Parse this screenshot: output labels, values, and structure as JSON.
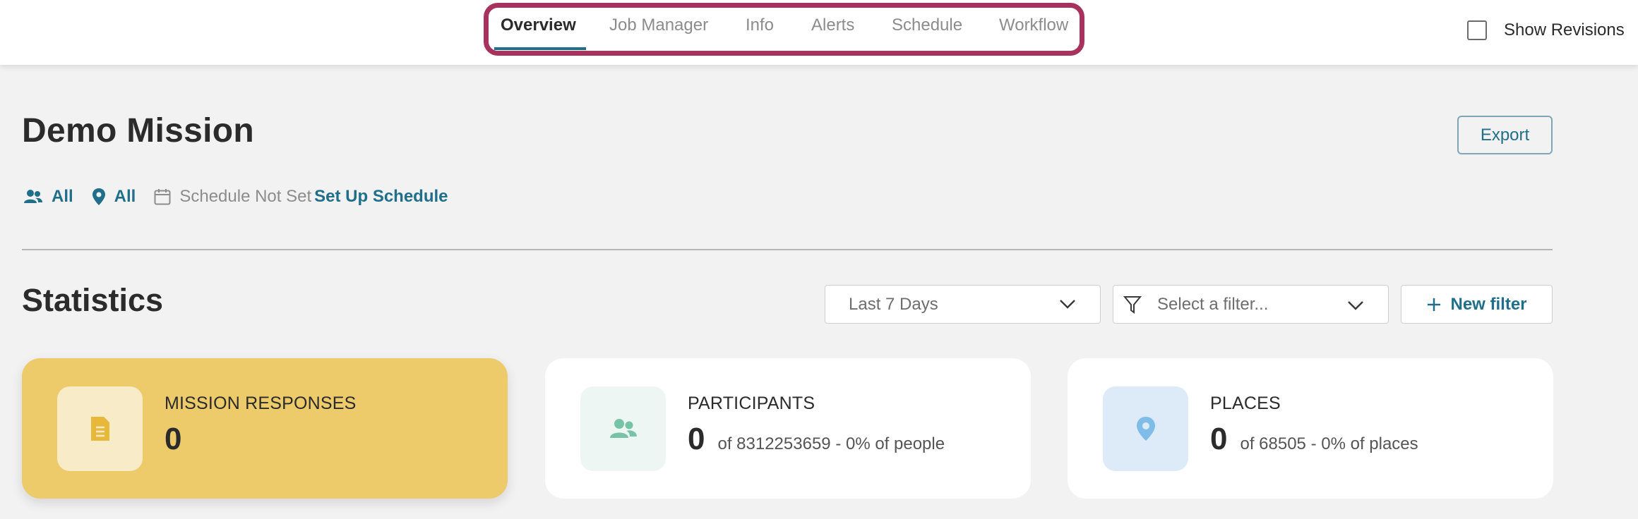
{
  "nav": {
    "tabs": [
      {
        "label": "Overview",
        "active": true
      },
      {
        "label": "Job Manager",
        "active": false
      },
      {
        "label": "Info",
        "active": false
      },
      {
        "label": "Alerts",
        "active": false
      },
      {
        "label": "Schedule",
        "active": false
      },
      {
        "label": "Workflow",
        "active": false
      }
    ],
    "show_revisions": {
      "label": "Show Revisions",
      "checked": false
    }
  },
  "header": {
    "title": "Demo Mission",
    "export_label": "Export",
    "people_filter": "All",
    "places_filter": "All",
    "schedule_status": "Schedule Not Set",
    "schedule_link": "Set Up Schedule"
  },
  "statistics": {
    "title": "Statistics",
    "date_range": {
      "value": "Last 7 Days"
    },
    "filter": {
      "placeholder": "Select a filter..."
    },
    "new_filter_label": "New filter",
    "cards": [
      {
        "label": "MISSION RESPONSES",
        "value": "0",
        "sub": "",
        "icon": "document-icon"
      },
      {
        "label": "PARTICIPANTS",
        "value": "0",
        "sub": "of 8312253659 - 0% of people",
        "icon": "people-icon"
      },
      {
        "label": "PLACES",
        "value": "0",
        "sub": "of 68505 - 0% of places",
        "icon": "location-pin-icon"
      }
    ]
  },
  "colors": {
    "accent": "#1f6f8b",
    "tab_highlight_border": "#a8325e",
    "responses_card": "#edcb6b",
    "participants_icon": "#76c3a8",
    "places_icon": "#7fbde8"
  }
}
